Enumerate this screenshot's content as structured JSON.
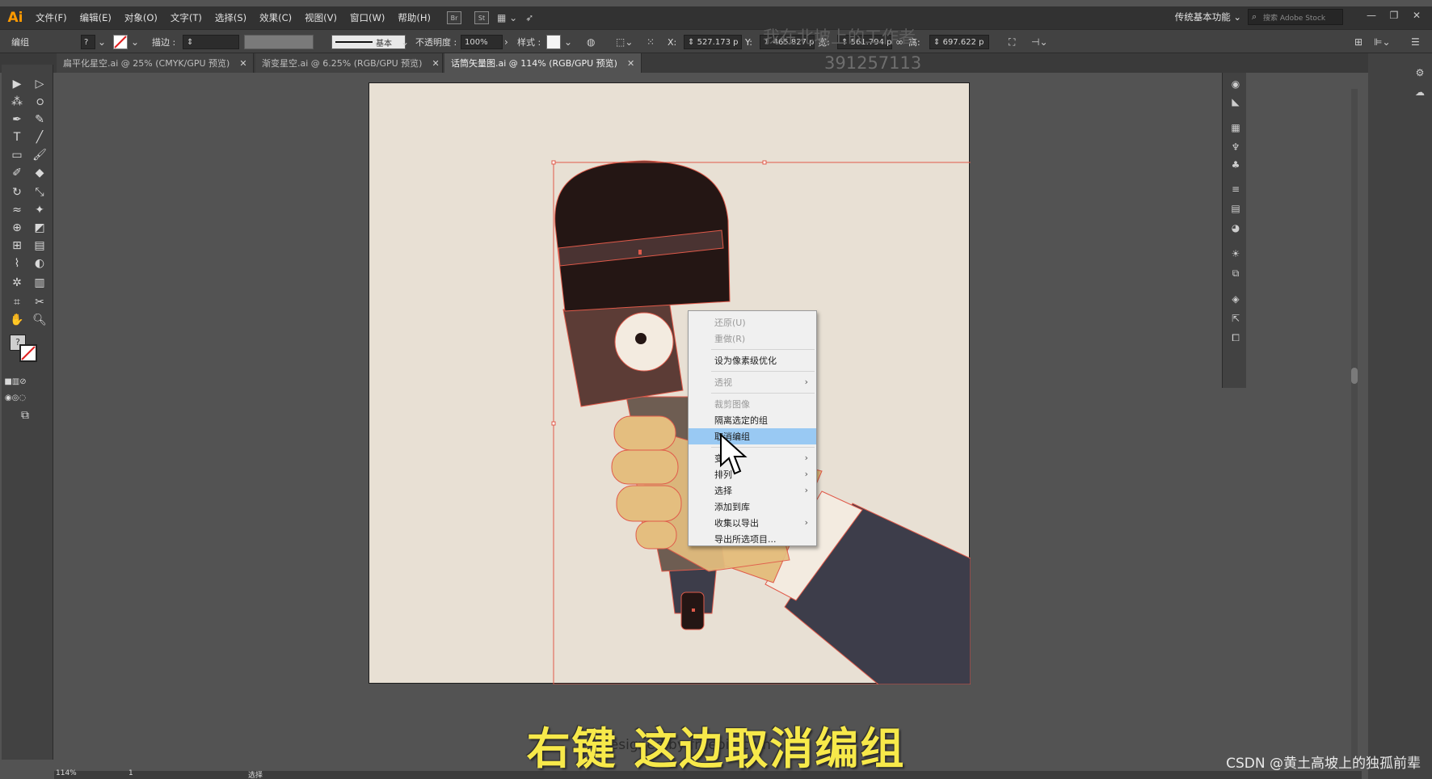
{
  "app": {
    "logo": "Ai",
    "accent": "#ff9a00"
  },
  "menu": [
    "文件(F)",
    "编辑(E)",
    "对象(O)",
    "文字(T)",
    "选择(S)",
    "效果(C)",
    "视图(V)",
    "窗口(W)",
    "帮助(H)"
  ],
  "bridge": {
    "br": "Br",
    "st": "St"
  },
  "workspace": "传统基本功能",
  "stock_search": "搜索 Adobe Stock",
  "control": {
    "selection_label": "编组",
    "stroke_label": "描边 :",
    "brush_label": "基本",
    "opacity_label": "不透明度 :",
    "opacity_value": "100%",
    "style_label": "样式 :",
    "x_label": "X:",
    "x_value": "527.173",
    "y_label": "Y:",
    "y_value": "465.827",
    "w_label": "宽:",
    "w_value": "561.794",
    "h_label": "高:",
    "h_value": "697.622",
    "unit": "p"
  },
  "tabs": [
    {
      "label": "扁平化星空.ai @ 25% (CMYK/GPU 预览)"
    },
    {
      "label": "渐变星空.ai @ 6.25% (RGB/GPU 预览)"
    },
    {
      "label": "话筒矢量图.ai @ 114% (RGB/GPU 预览)"
    }
  ],
  "context_menu": {
    "undo": "还原(U)",
    "redo": "重做(R)",
    "pixel_optimize": "设为像素级优化",
    "perspective": "透视",
    "crop_image": "裁剪图像",
    "isolate": "隔离选定的组",
    "ungroup": "取消编组",
    "transform": "变",
    "arrange": "排列",
    "select": "选择",
    "add_to_library": "添加到库",
    "collect_export": "收集以导出",
    "export_selection": "导出所选项目..."
  },
  "status": {
    "zoom": "114%",
    "page": "1",
    "tool": "选择"
  },
  "overlay": {
    "subtitle": "右键 这边取消编组",
    "designer": "designed by freepik.com",
    "watermark": "CSDN @黄土高坡上的独孤前辈",
    "uploader_id": "391257113",
    "uploader_tag": "我在北坡上的工作者"
  },
  "colors": {
    "artboard": "#e8e0d4",
    "mic_head": "#241614",
    "mic_band": "#4a3332",
    "mic_body": "#5c3c36",
    "hand": "#e4be7f",
    "cuff": "#f3ebe0",
    "sleeve": "#3d3d4a",
    "selection": "#e05a4a",
    "menu_highlight": "#99c9f3",
    "subtitle": "#f7e94a"
  }
}
